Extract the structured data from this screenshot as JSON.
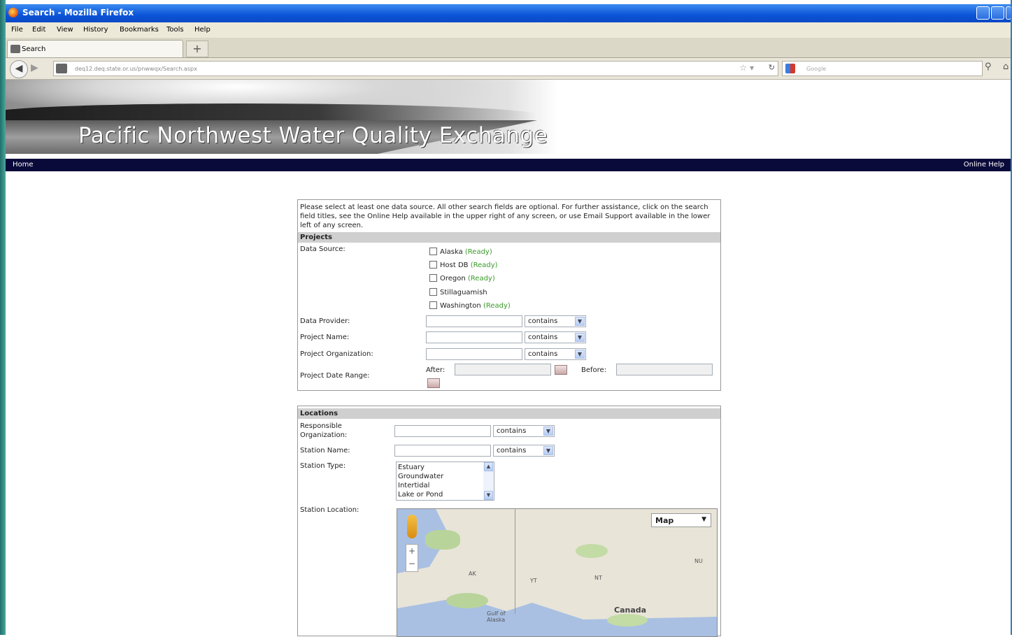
{
  "window": {
    "title": "Search - Mozilla Firefox"
  },
  "menu": [
    "File",
    "Edit",
    "View",
    "History",
    "Bookmarks",
    "Tools",
    "Help"
  ],
  "tab": {
    "label": "Search",
    "new_tab": "+"
  },
  "navbar": {
    "url": "deq12.deq.state.or.us/pnwwqx/Search.aspx",
    "search_placeholder": "Google"
  },
  "banner": {
    "title": "Pacific Northwest Water Quality Exchange"
  },
  "topnav": {
    "home": "Home",
    "help": "Online Help"
  },
  "intro": "Please select at least one data source. All other search fields are optional. For further assistance, click on the search field titles, see the Online Help available in the upper right of any screen, or use Email Support available in the lower left of any screen.",
  "projects": {
    "heading": "Projects",
    "data_source_label": "Data Source:",
    "sources": [
      {
        "name": "Alaska",
        "status": "(Ready)"
      },
      {
        "name": "Host DB",
        "status": "(Ready)"
      },
      {
        "name": "Oregon",
        "status": "(Ready)"
      },
      {
        "name": "Stillaguamish",
        "status": ""
      },
      {
        "name": "Washington",
        "status": "(Ready)"
      }
    ],
    "data_provider_label": "Data Provider:",
    "project_name_label": "Project Name:",
    "project_org_label": "Project Organization:",
    "match_option": "contains",
    "date_range_label": "Project Date Range:",
    "after_label": "After:",
    "before_label": "Before:"
  },
  "locations": {
    "heading": "Locations",
    "resp_org_label_1": "Responsible",
    "resp_org_label_2": "Organization:",
    "station_name_label": "Station Name:",
    "station_type_label": "Station Type:",
    "station_types": [
      "Estuary",
      "Groundwater",
      "Intertidal",
      "Lake or Pond"
    ],
    "station_location_label": "Station Location:",
    "match_option": "contains"
  },
  "map": {
    "type_selected": "Map",
    "labels": {
      "ak": "AK",
      "yt": "YT",
      "nt": "NT",
      "nu": "NU",
      "gulf_1": "Gulf of",
      "gulf_2": "Alaska",
      "canada": "Canada"
    }
  }
}
